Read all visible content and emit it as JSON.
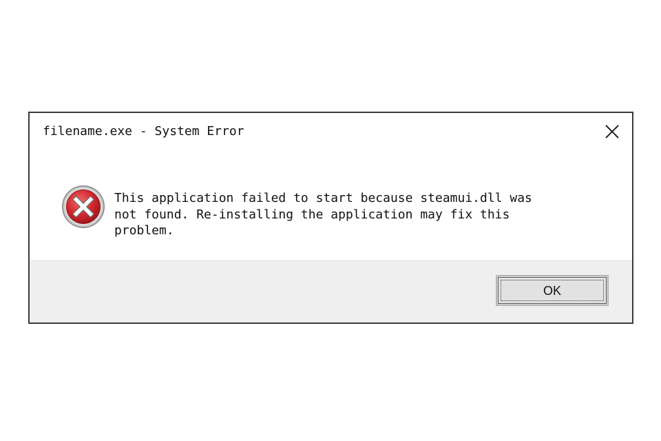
{
  "dialog": {
    "title": "filename.exe - System Error",
    "close_icon": "close-icon",
    "status_icon": "error-icon",
    "message_lines": [
      "This application failed to start because steamui.dll was",
      "not found. Re-installing the application may fix this",
      "problem."
    ],
    "ok_label": "OK"
  },
  "colors": {
    "border": "#3a3a3a",
    "footer_bg": "#efefef",
    "error_red": "#c8262d",
    "button_bg": "#e2e2e2"
  }
}
